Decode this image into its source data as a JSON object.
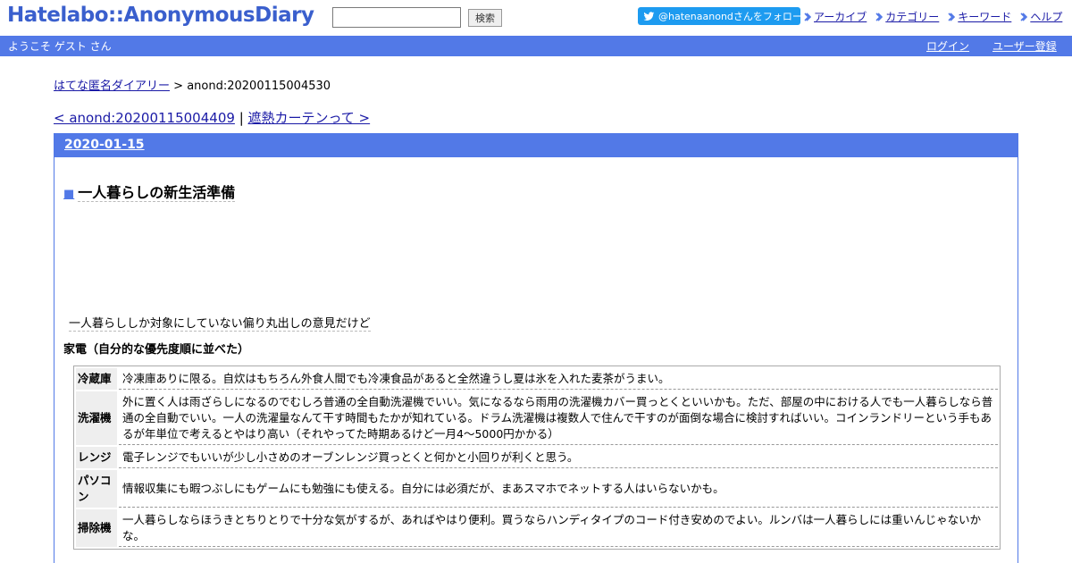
{
  "header": {
    "logo": "Hatelabo::AnonymousDiary",
    "search_placeholder": "",
    "search_button": "検索",
    "twitter_follow": "@hatenaanondさんをフォロー",
    "nav": [
      "アーカイブ",
      "カテゴリー",
      "キーワード",
      "ヘルプ"
    ]
  },
  "userbar": {
    "welcome": "ようこそ ゲスト さん",
    "login": "ログイン",
    "register": "ユーザー登録"
  },
  "breadcrumb": {
    "home": "はてな匿名ダイアリー",
    "separator": ">",
    "current": "anond:20200115004530"
  },
  "pager": {
    "prev": "< anond:20200115004409",
    "separator": "|",
    "next": "遮熱カーテンって >"
  },
  "day": {
    "date": "2020-01-15",
    "entry": {
      "bullet": "■",
      "title": "一人暮らしの新生活準備",
      "intro": "一人暮らししか対象にしていない偏り丸出しの意見だけど",
      "section": "家電（自分的な優先度順に並べた）",
      "rows": [
        {
          "name": "冷蔵庫",
          "text": "冷凍庫ありに限る。自炊はもちろん外食人間でも冷凍食品があると全然違うし夏は氷を入れた麦茶がうまい。"
        },
        {
          "name": "洗濯機",
          "text": "外に置く人は雨ざらしになるのでむしろ普通の全自動洗濯機でいい。気になるなら雨用の洗濯機カバー買っとくといいかも。ただ、部屋の中における人でも一人暮らしなら普通の全自動でいい。一人の洗濯量なんて干す時間もたかが知れている。ドラム洗濯機は複数人で住んで干すのが面倒な場合に検討すればいい。コインランドリーという手もあるが年単位で考えるとやはり高い（それやってた時期あるけど一月4～5000円かかる）"
        },
        {
          "name": "レンジ",
          "text": "電子レンジでもいいが少し小さめのオーブンレンジ買っとくと何かと小回りが利くと思う。"
        },
        {
          "name": "パソコン",
          "text": "情報収集にも暇つぶしにもゲームにも勉強にも使える。自分には必須だが、まあスマホでネットする人はいらないかも。"
        },
        {
          "name": "掃除機",
          "text": "一人暮らしならほうきとちりとりで十分な気がするが、あればやはり便利。買うならハンディタイプのコード付き安めのでよい。ルンバは一人暮らしには重いんじゃないかな。"
        }
      ]
    }
  },
  "colors": {
    "accent": "#5279e7",
    "link": "#1a1aa6",
    "logo": "#3a5fcd",
    "twitter": "#1d9bf0"
  }
}
